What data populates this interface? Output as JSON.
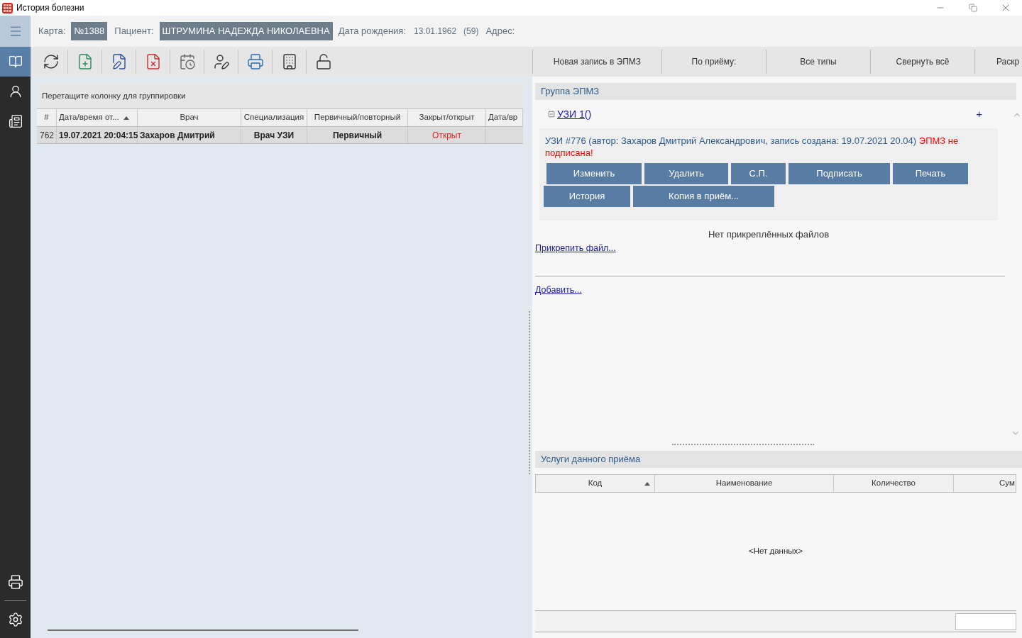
{
  "window": {
    "title": "История болезни"
  },
  "header": {
    "card_label": "Карта:",
    "card_value": "№1388",
    "patient_label": "Пациент:",
    "patient_value": "ШТРУМИНА НАДЕЖДА НИКОЛАЕВНА",
    "birth_label": "Дата рождения:",
    "birth_value": "13.01.1962",
    "age": "(59)",
    "address_label": "Адрес:"
  },
  "sidebar": {
    "items": [
      {
        "kind": "book",
        "selected": true
      },
      {
        "kind": "patient",
        "selected": false
      },
      {
        "kind": "list",
        "selected": false
      }
    ]
  },
  "right_toolbar": [
    "Новая запись в ЭПМЗ",
    "По приёму:",
    "Все типы",
    "Свернуть всё",
    "Раскр"
  ],
  "grid": {
    "group_hint": "Перетащите колонку для группировки",
    "columns": [
      {
        "label": "#",
        "sorted": false
      },
      {
        "label": "Дата/время от...",
        "sorted": true
      },
      {
        "label": "Врач",
        "sorted": false
      },
      {
        "label": "Специализация",
        "sorted": false
      },
      {
        "label": "Первичный/повторный",
        "sorted": false
      },
      {
        "label": "Закрыт/открыт",
        "sorted": false
      },
      {
        "label": "Дата/вр"
      }
    ],
    "rows": [
      {
        "selected": true,
        "number": "762",
        "datetime": "19.07.2021 20:04:15",
        "doctor": "Захаров Дмитрий",
        "specialization": "Врач УЗИ",
        "visit_type": "Первичный",
        "status": {
          "text": "Открыт",
          "open": true
        }
      }
    ]
  },
  "epmz": {
    "group_title": "Группа ЭПМЗ",
    "entry": {
      "title": "УЗИ 1()",
      "expanded": true,
      "description": "УЗИ #776 (автор: Захаров Дмитрий Александрович, запись создана: 19.07.2021 20.04)",
      "warning": "ЭПМЗ не подписана!",
      "buttons": [
        "Изменить",
        "Удалить",
        "С.П.",
        "Подписать",
        "Печать",
        "История",
        "Копия в приём..."
      ]
    },
    "add_symbol": "+",
    "no_files": "Нет прикреплённых файлов",
    "attach_link": "Прикрепить файл...",
    "add_link": "Добавить..."
  },
  "services": {
    "title": "Услуги данного приёма",
    "columns": [
      {
        "label": "Код",
        "sorted": true
      },
      {
        "label": "Наименование",
        "sorted": false
      },
      {
        "label": "Количество",
        "sorted": false
      },
      {
        "label": "Сум"
      }
    ],
    "empty": "<Нет данных>"
  }
}
